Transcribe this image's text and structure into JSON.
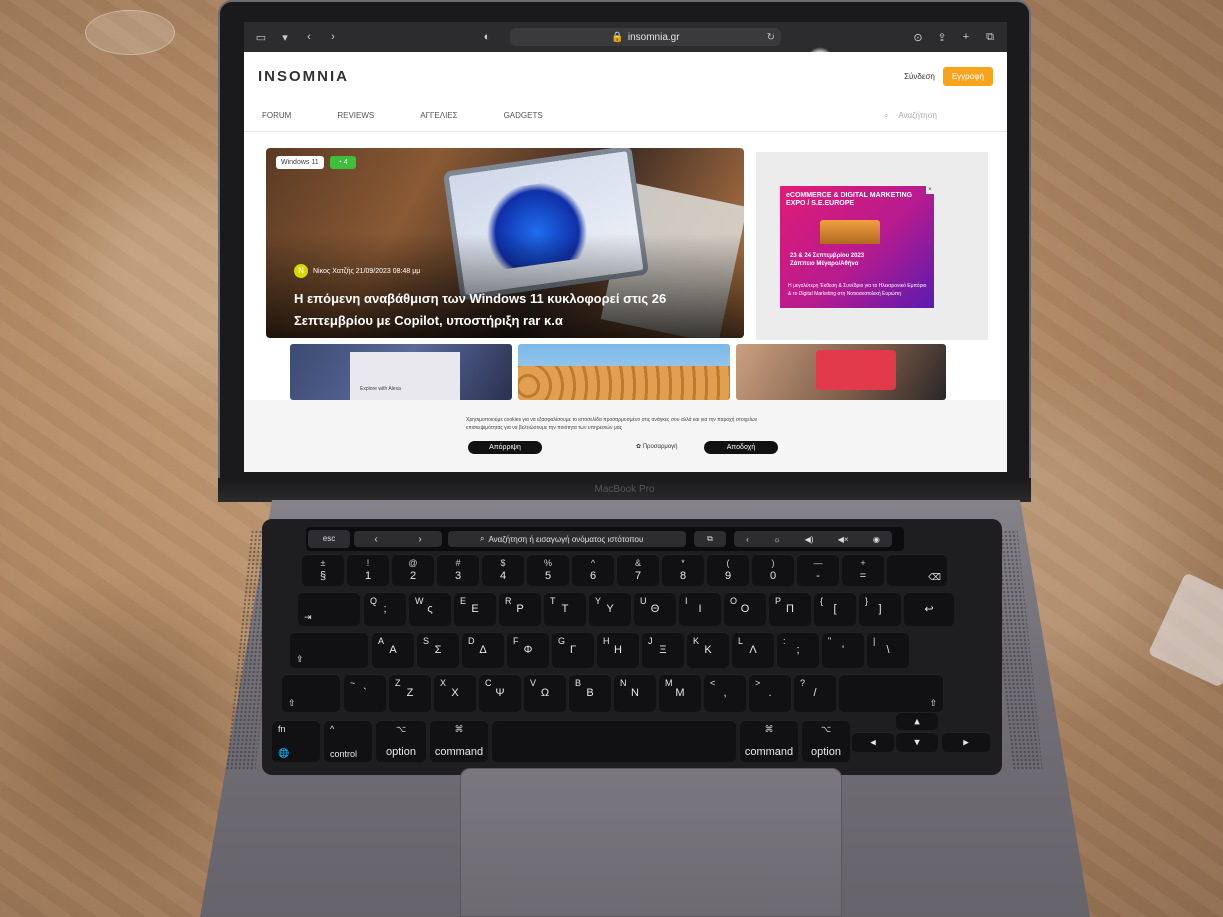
{
  "browser": {
    "url": "insomnia.gr",
    "lock_icon": "lock-icon",
    "reload_icon": "reload-icon"
  },
  "site": {
    "logo_text": "INSOMNIA",
    "login_label": "Σύνδεση",
    "register_label": "Εγγραφή",
    "accent_color": "#f7a41d",
    "nav": [
      "FORUM",
      "REVIEWS",
      "ΑΓΓΕΛΙΕΣ",
      "GADGETS"
    ],
    "search_placeholder": "Αναζήτηση"
  },
  "hero": {
    "badge_category": "Windows 11",
    "badge_comments": "4",
    "author_initial": "N",
    "author_meta": "Νίκος Χατζής 21/09/2023 08:48 μμ",
    "title": "Η επόμενη αναβάθμιση των Windows 11 κυκλοφορεί στις 26 Σεπτεμβρίου με Copilot, υποστήριξη rar κ.α"
  },
  "ad": {
    "title": "eCOMMERCE & DIGITAL MARKETING EXPO / S.E.EUROPE",
    "date": "23 & 24 Σεπτεμβρίου 2023",
    "venue": "Ζάππειο Μέγαρο/Αθήνα",
    "desc": "Η μεγαλύτερη Έκθεση & Συνέδριο για το Ηλεκτρονικό Εμπόριο & το Digital Marketing στη Νοτιοανατολική Ευρώπη"
  },
  "thumbs": {
    "thumb1_label": "Explore with Alexa"
  },
  "cookie": {
    "text": "Χρησιμοποιούμε cookies για να εξασφαλίσουμε το ιστοσελίδα προσαρμοσμένο στις ανάγκες σου αλλά και για την παροχή στοιχείων επισκεψιμότητας για να βελτιώσουμε την ποιότητα των υπηρεσιών μας",
    "reject_label": "Απόρριψη",
    "customize_label": "Προσαρμογή",
    "accept_label": "Αποδοχή"
  },
  "laptop": {
    "model_label": "MacBook Pro"
  },
  "touchbar": {
    "esc": "esc",
    "search_label": "Αναζήτηση ή εισαγωγή ονόματος ιστότοπου"
  },
  "keys": {
    "row1": [
      {
        "t": "±",
        "b": "§"
      },
      {
        "t": "!",
        "b": "1"
      },
      {
        "t": "@",
        "b": "2"
      },
      {
        "t": "#",
        "b": "3"
      },
      {
        "t": "$",
        "b": "4"
      },
      {
        "t": "%",
        "b": "5"
      },
      {
        "t": "^",
        "b": "6"
      },
      {
        "t": "&",
        "b": "7"
      },
      {
        "t": "*",
        "b": "8"
      },
      {
        "t": "(",
        "b": "9"
      },
      {
        "t": ")",
        "b": "0"
      },
      {
        "t": "—",
        "b": "-"
      },
      {
        "t": "+",
        "b": "="
      }
    ],
    "row2": [
      {
        "t": "Q",
        "b": ";"
      },
      {
        "t": "W",
        "b": "ς"
      },
      {
        "t": "E",
        "b": "Ε"
      },
      {
        "t": "R",
        "b": "Ρ"
      },
      {
        "t": "T",
        "b": "Τ"
      },
      {
        "t": "Y",
        "b": "Υ"
      },
      {
        "t": "U",
        "b": "Θ"
      },
      {
        "t": "I",
        "b": "Ι"
      },
      {
        "t": "O",
        "b": "Ο"
      },
      {
        "t": "P",
        "b": "Π"
      },
      {
        "t": "{",
        "b": "["
      },
      {
        "t": "}",
        "b": "]"
      }
    ],
    "row3": [
      {
        "t": "A",
        "b": "Α"
      },
      {
        "t": "S",
        "b": "Σ"
      },
      {
        "t": "D",
        "b": "Δ"
      },
      {
        "t": "F",
        "b": "Φ"
      },
      {
        "t": "G",
        "b": "Γ"
      },
      {
        "t": "H",
        "b": "Η"
      },
      {
        "t": "J",
        "b": "Ξ"
      },
      {
        "t": "K",
        "b": "Κ"
      },
      {
        "t": "L",
        "b": "Λ"
      },
      {
        "t": ":",
        "b": ";"
      },
      {
        "t": "\"",
        "b": "'"
      },
      {
        "t": "|",
        "b": "\\"
      }
    ],
    "row4": [
      {
        "t": "~",
        "b": "`"
      },
      {
        "t": "Z",
        "b": "Ζ"
      },
      {
        "t": "X",
        "b": "Χ"
      },
      {
        "t": "C",
        "b": "Ψ"
      },
      {
        "t": "V",
        "b": "Ω"
      },
      {
        "t": "B",
        "b": "Β"
      },
      {
        "t": "N",
        "b": "Ν"
      },
      {
        "t": "M",
        "b": "Μ"
      },
      {
        "t": "<",
        "b": ","
      },
      {
        "t": ">",
        "b": "."
      },
      {
        "t": "?",
        "b": "/"
      }
    ],
    "tab_label": "⇥",
    "caps_label": "⇪",
    "shift_label": "⇧",
    "delete_label": "⌫",
    "return_label": "↩",
    "fn_label": "fn",
    "control_label": "control",
    "option_label": "option",
    "command_label": "command",
    "option_symbol": "⌥",
    "command_symbol": "⌘",
    "control_symbol": "^",
    "globe_symbol": "🌐"
  }
}
